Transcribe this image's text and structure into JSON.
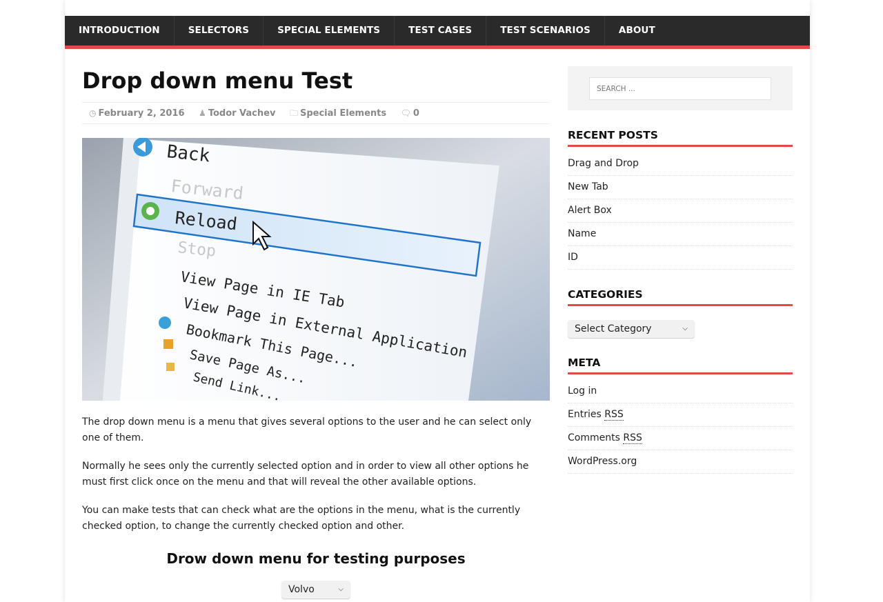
{
  "nav": {
    "items": [
      {
        "label": "INTRODUCTION"
      },
      {
        "label": "SELECTORS"
      },
      {
        "label": "SPECIAL ELEMENTS"
      },
      {
        "label": "TEST CASES"
      },
      {
        "label": "TEST SCENARIOS"
      },
      {
        "label": "ABOUT"
      }
    ]
  },
  "post": {
    "title": "Drop down menu Test",
    "date": "February 2, 2016",
    "author": "Todor Vachev",
    "category": "Special Elements",
    "comments": "0",
    "image": {
      "menu_items": [
        "Back",
        "Forward",
        "Reload",
        "Stop",
        "View Page in IE Tab",
        "View Page in External Application",
        "Bookmark This Page...",
        "Save Page As...",
        "Send Link..."
      ]
    },
    "paragraphs": [
      "The drop down menu is a menu that gives several options to the user and he can select only one of them.",
      "Normally he sees only the currently selected option and in order to view all other options he must first click once on the menu and that will reveal the other available options.",
      "You can make tests that can check what are the options in the menu, what is the currently checked option, to change the currently checked option and other."
    ],
    "section_title": "Drow down menu for testing purposes",
    "select_value": "Volvo"
  },
  "sidebar": {
    "search_placeholder": "SEARCH ...",
    "recent_posts": {
      "title": "RECENT POSTS",
      "items": [
        "Drag and Drop",
        "New Tab",
        "Alert Box",
        "Name",
        "ID"
      ]
    },
    "categories": {
      "title": "CATEGORIES",
      "select_value": "Select Category"
    },
    "meta": {
      "title": "META",
      "log_in": "Log in",
      "entries_prefix": "Entries",
      "comments_prefix": "Comments",
      "rss": "RSS",
      "wordpress": "WordPress.org"
    }
  },
  "colors": {
    "accent": "#e04b4a",
    "nav_bg": "#2a2a2a"
  }
}
